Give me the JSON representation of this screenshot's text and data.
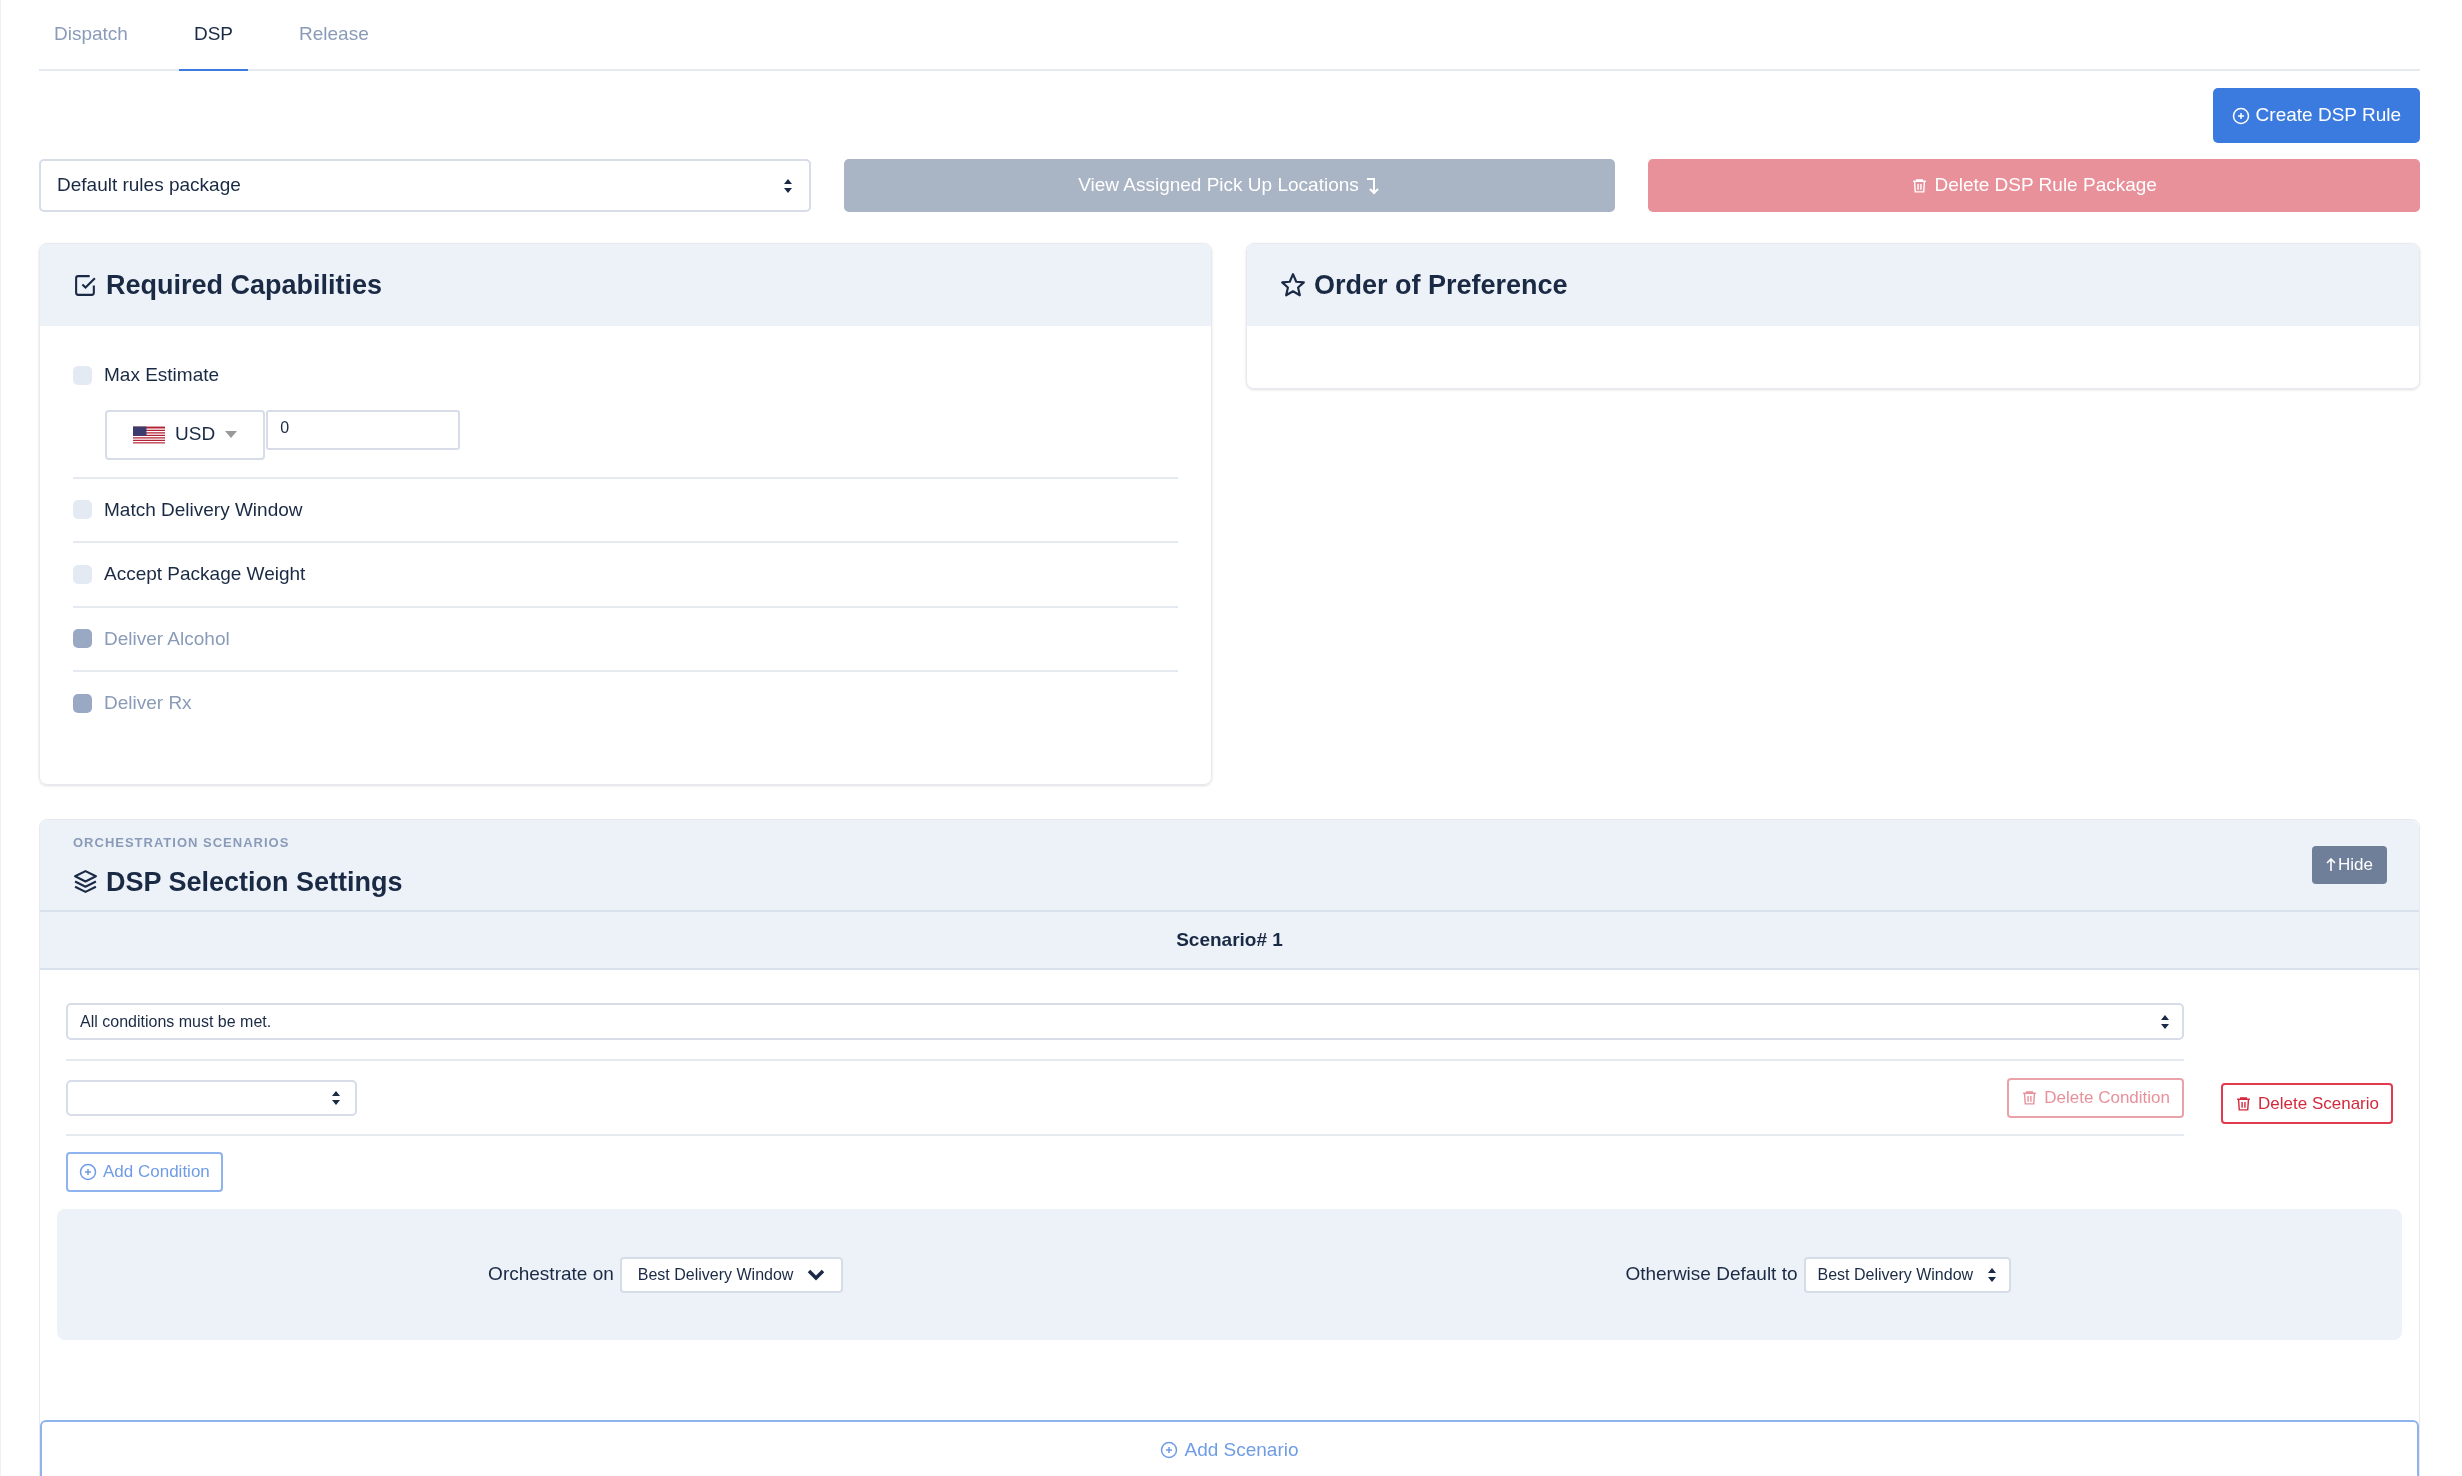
{
  "tabs": [
    {
      "label": "Dispatch",
      "selected": false
    },
    {
      "label": "DSP",
      "selected": true
    },
    {
      "label": "Release",
      "selected": false
    }
  ],
  "create_button": "Create DSP Rule",
  "package_select": {
    "value": "Default rules package"
  },
  "view_locations_button": "View Assigned Pick Up Locations",
  "delete_package_button": "Delete DSP Rule Package",
  "required_capabilities": {
    "title": "Required Capabilities",
    "items": [
      {
        "kind": "amount",
        "label": "Max Estimate",
        "checked": false,
        "disabled": false,
        "currency": "USD",
        "value": "0"
      },
      {
        "kind": "plain",
        "label": "Match Delivery Window",
        "checked": false,
        "disabled": false
      },
      {
        "kind": "plain",
        "label": "Accept Package Weight",
        "checked": false,
        "disabled": false
      },
      {
        "kind": "plain",
        "label": "Deliver Alcohol",
        "checked": false,
        "disabled": true
      },
      {
        "kind": "plain",
        "label": "Deliver Rx",
        "checked": false,
        "disabled": true
      }
    ]
  },
  "order_of_preference": {
    "title": "Order of Preference"
  },
  "scenarios_section": {
    "eyebrow": "ORCHESTRATION SCENARIOS",
    "title": "DSP Selection Settings",
    "hide_button": "Hide",
    "scenarios": [
      {
        "title": "Scenario# 1",
        "match_select": "All conditions must be met.",
        "conditions": [
          {
            "delete_button": "Delete Condition"
          }
        ],
        "add_condition_button": "Add Condition",
        "delete_scenario_button": "Delete Scenario",
        "orchestrate_label": "Orchestrate on",
        "orchestrate_value": "Best Delivery Window",
        "default_label": "Otherwise Default to",
        "default_value": "Best Delivery Window"
      }
    ],
    "add_scenario_button": "Add Scenario"
  }
}
